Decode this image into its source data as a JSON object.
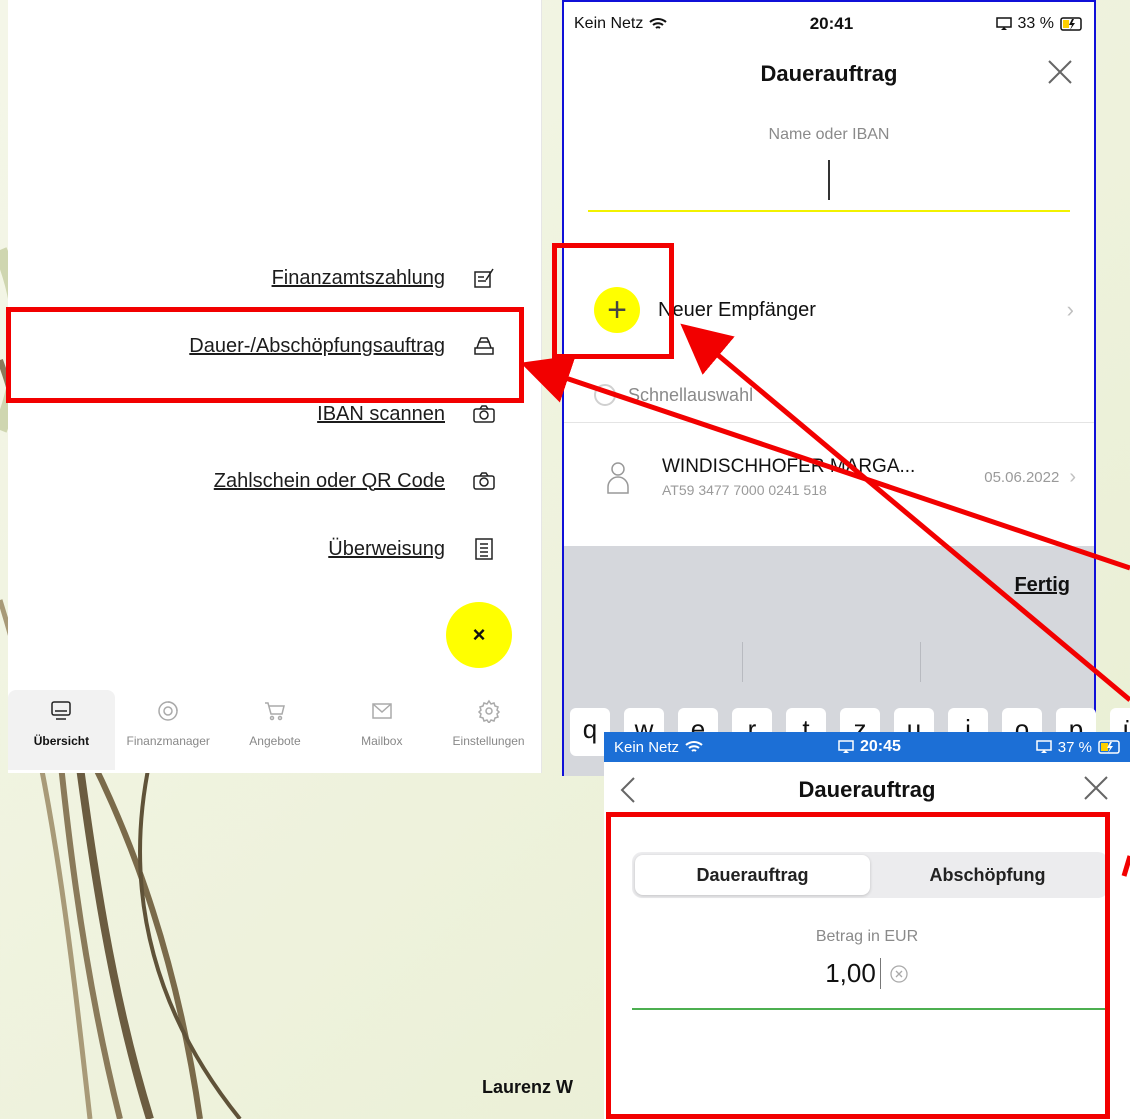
{
  "colors": {
    "accent_yellow": "#ffff00",
    "annotation_red": "#f20000",
    "frame_blue": "#1010d8",
    "statusbar_blue": "#1c6fd6",
    "underline_green": "#4caf50"
  },
  "left_menu": {
    "items": [
      {
        "label": "Finanzamtszahlung",
        "icon": "form-edit-icon"
      },
      {
        "label": "Dauer-/Abschöpfungsauftrag",
        "icon": "stacked-tray-icon"
      },
      {
        "label": "IBAN scannen",
        "icon": "camera-icon"
      },
      {
        "label": "Zahlschein oder QR Code",
        "icon": "camera-icon"
      },
      {
        "label": "Überweisung",
        "icon": "document-list-icon"
      }
    ],
    "close_symbol": "×"
  },
  "tab_bar": {
    "tabs": [
      {
        "label": "Übersicht",
        "icon": "monitor-icon",
        "active": true
      },
      {
        "label": "Finanzmanager",
        "icon": "circle-progress-icon",
        "active": false
      },
      {
        "label": "Angebote",
        "icon": "cart-icon",
        "active": false
      },
      {
        "label": "Mailbox",
        "icon": "envelope-icon",
        "active": false
      },
      {
        "label": "Einstellungen",
        "icon": "gear-icon",
        "active": false
      }
    ]
  },
  "phone_mid": {
    "status": {
      "carrier": "Kein Netz",
      "time": "20:41",
      "battery": "33 %"
    },
    "title": "Dauerauftrag",
    "name_field_label": "Name oder IBAN",
    "new_recipient": "Neuer Empfänger",
    "quick_select": "Schnellauswahl",
    "contact": {
      "name": "WINDISCHHOFER MARGA...",
      "iban": "AT59 3477 7000 0241 518",
      "date": "05.06.2022"
    },
    "done": "Fertig",
    "keys": [
      "q",
      "w",
      "e",
      "r",
      "t",
      "z",
      "u",
      "i",
      "o",
      "p",
      "ü"
    ]
  },
  "phone_bot": {
    "status": {
      "carrier": "Kein Netz",
      "time": "20:45",
      "battery": "37 %"
    },
    "title": "Dauerauftrag",
    "segments": [
      {
        "label": "Dauerauftrag",
        "active": true
      },
      {
        "label": "Abschöpfung",
        "active": false
      }
    ],
    "amount_label": "Betrag in EUR",
    "amount_value": "1,00"
  },
  "footer": {
    "author": "Laurenz W"
  }
}
